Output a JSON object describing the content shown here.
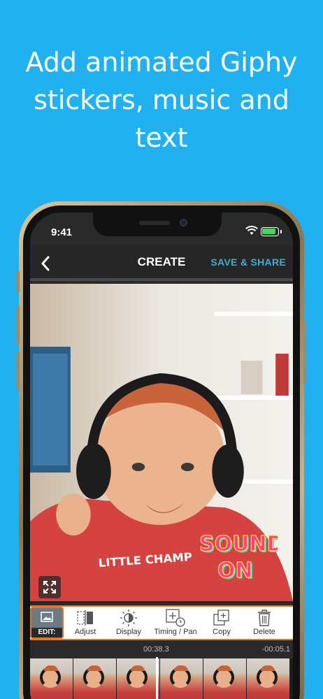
{
  "headline": {
    "line1": "Add animated Giphy",
    "line2": "stickers, music and",
    "line3": "text"
  },
  "status_bar": {
    "time": "9:41"
  },
  "nav": {
    "title": "CREATE",
    "share_label": "SAVE & SHARE",
    "back_icon": "chevron-left-icon"
  },
  "sticker": {
    "line1": "SOUND",
    "line2": "ON"
  },
  "toolbar": {
    "thumb_label": "EDIT:",
    "tools": [
      {
        "label": "Adjust",
        "icon": "adjust-icon"
      },
      {
        "label": "Display",
        "icon": "brightness-icon"
      },
      {
        "label": "Timing / Pan",
        "icon": "timing-pan-icon"
      },
      {
        "label": "Copy",
        "icon": "copy-icon"
      },
      {
        "label": "Delete",
        "icon": "trash-icon"
      }
    ]
  },
  "timeline": {
    "current": "00:38.3",
    "remaining": "-00:05.1"
  },
  "colors": {
    "background": "#22b1f0",
    "accent": "#e8742a",
    "share": "#3ab0d6"
  }
}
